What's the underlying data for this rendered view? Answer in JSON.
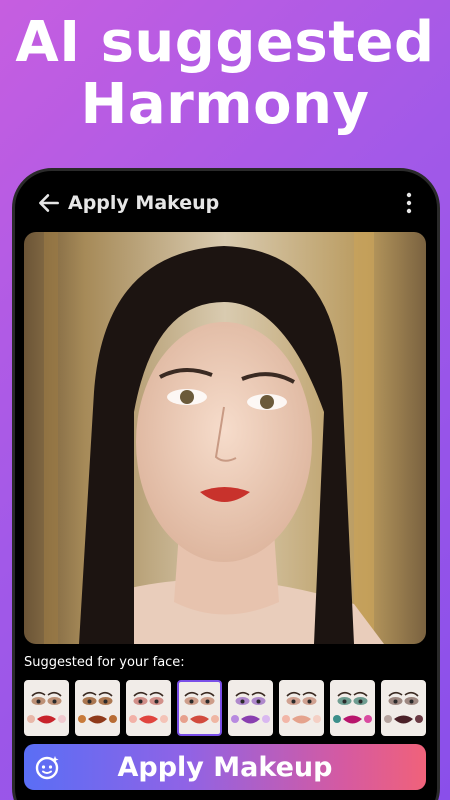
{
  "headline": {
    "line1": "AI suggested",
    "line2": "Harmony"
  },
  "topbar": {
    "title": "Apply Makeup",
    "back_icon": "arrow-left-icon",
    "menu_icon": "more-vertical-icon"
  },
  "suggestions": {
    "label": "Suggested for your face:",
    "selected_index": 3,
    "styles": [
      {
        "eye": "#b07a5a",
        "lip": "#c8232b",
        "dot1": "#e8b7a8",
        "dot2": "#f0c9cf"
      },
      {
        "eye": "#9a5a2a",
        "lip": "#8f3a1b",
        "dot1": "#c87a3a",
        "dot2": "#b86c34"
      },
      {
        "eye": "#c97870",
        "lip": "#e0453f",
        "dot1": "#f2b1a7",
        "dot2": "#f4c3b7"
      },
      {
        "eye": "#c48a72",
        "lip": "#d24b3e",
        "dot1": "#e7a08d",
        "dot2": "#f0b6a3"
      },
      {
        "eye": "#9f6fc4",
        "lip": "#8a3fb0",
        "dot1": "#b88ae0",
        "dot2": "#d9b8f0"
      },
      {
        "eye": "#c88f7a",
        "lip": "#e5a38d",
        "dot1": "#f2b6a8",
        "dot2": "#f4cfc4"
      },
      {
        "eye": "#4f8a7a",
        "lip": "#b8156c",
        "dot1": "#3c8f8a",
        "dot2": "#d94aa0"
      },
      {
        "eye": "#8a6f66",
        "lip": "#4a2028",
        "dot1": "#b5a39e",
        "dot2": "#6b3a44"
      }
    ]
  },
  "apply_button": {
    "label": "Apply Makeup",
    "icon": "face-sparkle-icon"
  }
}
